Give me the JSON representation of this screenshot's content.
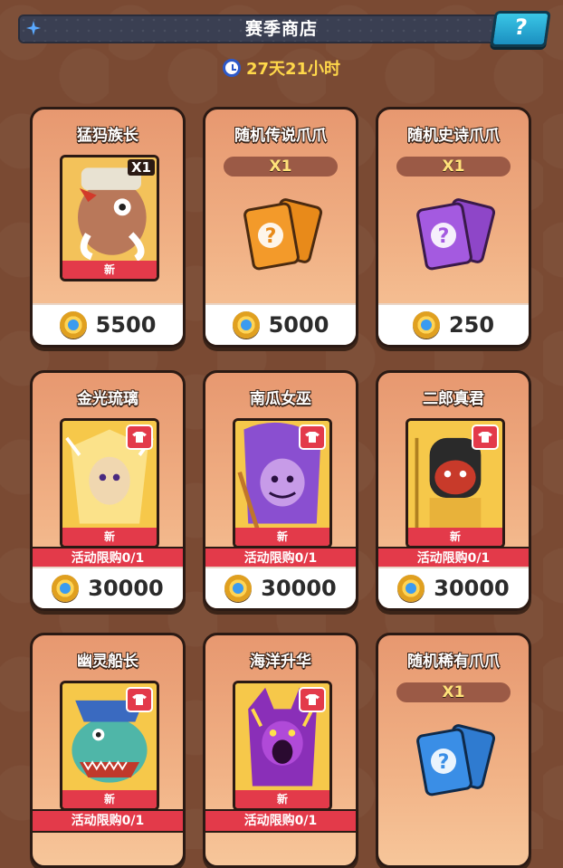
{
  "header": {
    "title": "赛季商店",
    "help_label": "?"
  },
  "timer": {
    "text": "27天21小时"
  },
  "colors": {
    "legendary": "#f39a2a",
    "epic": "#a45ae0",
    "rare": "#3a8ee6",
    "new_badge": "#e33a4a"
  },
  "cards": [
    {
      "title": "猛犸族长",
      "badge": "X1",
      "new_label": "新",
      "price": "5500"
    },
    {
      "title": "随机传说爪爪",
      "qty": "X1",
      "price": "5000"
    },
    {
      "title": "随机史诗爪爪",
      "qty": "X1",
      "price": "250"
    },
    {
      "title": "金光琉璃",
      "new_label": "新",
      "limit": "活动限购0/1",
      "price": "30000"
    },
    {
      "title": "南瓜女巫",
      "new_label": "新",
      "limit": "活动限购0/1",
      "price": "30000"
    },
    {
      "title": "二郎真君",
      "new_label": "新",
      "limit": "活动限购0/1",
      "price": "30000"
    },
    {
      "title": "幽灵船长",
      "new_label": "新",
      "limit": "活动限购0/1"
    },
    {
      "title": "海洋升华",
      "new_label": "新",
      "limit": "活动限购0/1"
    },
    {
      "title": "随机稀有爪爪",
      "qty": "X1"
    }
  ]
}
